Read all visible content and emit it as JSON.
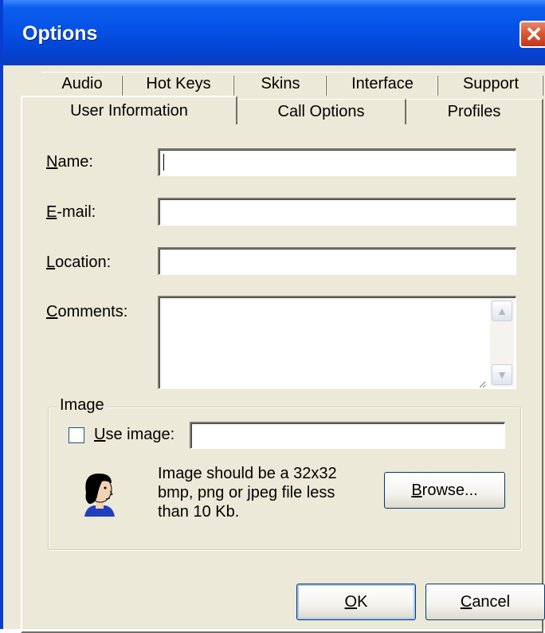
{
  "window": {
    "title": "Options",
    "close_icon": "close-icon"
  },
  "tabs": {
    "back_row": [
      "Audio",
      "Hot Keys",
      "Skins",
      "Interface",
      "Support"
    ],
    "front_row": [
      "User Information",
      "Call Options",
      "Profiles"
    ],
    "active": "User Information"
  },
  "form": {
    "name": {
      "label_accel": "N",
      "label_rest": "ame:",
      "value": ""
    },
    "email": {
      "label_accel": "E",
      "label_rest": "-mail:",
      "value": ""
    },
    "location": {
      "label_accel": "L",
      "label_rest": "ocation:",
      "value": ""
    },
    "comments": {
      "label_accel": "C",
      "label_rest": "omments:",
      "value": ""
    }
  },
  "image_group": {
    "label": "Image",
    "use_image_accel": "U",
    "use_image_rest": "se image:",
    "use_image_checked": false,
    "path_value": "",
    "hint_lines": [
      "Image should be a 32x32",
      "bmp, png or jpeg file less",
      "than 10 Kb."
    ],
    "browse_accel": "B",
    "browse_rest": "rowse...",
    "avatar_icon": "person-avatar-icon"
  },
  "buttons": {
    "ok_accel": "O",
    "ok_rest": "K",
    "cancel_accel": "C",
    "cancel_rest": "ancel"
  },
  "colors": {
    "titlebar": "#0552e6",
    "dialog_bg": "#ece9d8",
    "close_button": "#d8552f"
  }
}
